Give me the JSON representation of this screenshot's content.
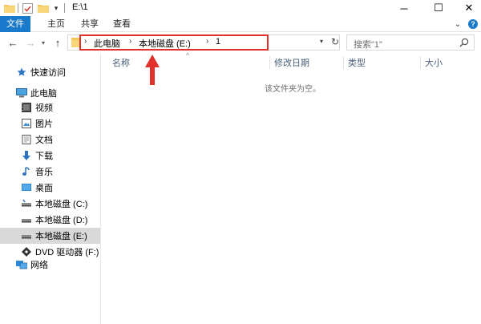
{
  "window": {
    "title": "E:\\1",
    "minimize_glyph": "─",
    "maximize_glyph": "☐",
    "close_glyph": "✕"
  },
  "ribbon": {
    "tabs": [
      "文件",
      "主页",
      "共享",
      "查看"
    ],
    "accent": "#1979ca",
    "help_glyph": "?"
  },
  "address": {
    "crumbs": [
      "此电脑",
      "本地磁盘 (E:)",
      "1"
    ],
    "separator": "›",
    "highlight_color": "#e0312b"
  },
  "search": {
    "placeholder": "搜索\"1\""
  },
  "nav": {
    "quick_access": "快速访问",
    "this_pc": "此电脑",
    "items": [
      "视频",
      "图片",
      "文档",
      "下载",
      "音乐",
      "桌面",
      "本地磁盘 (C:)",
      "本地磁盘 (D:)",
      "本地磁盘 (E:)",
      "DVD 驱动器 (F:) Bo"
    ],
    "network": "网络",
    "selected": "本地磁盘 (E:)"
  },
  "columns": [
    "名称",
    "修改日期",
    "类型",
    "大小"
  ],
  "empty_message": "该文件夹为空。",
  "icons": {
    "quick_access": "star-icon",
    "pc": "computer-icon",
    "video": "video-icon",
    "pictures": "pictures-icon",
    "documents": "documents-icon",
    "downloads": "download-arrow-icon",
    "music": "music-note-icon",
    "desktop": "desktop-icon",
    "drive": "drive-icon",
    "dvd": "dvd-icon",
    "network": "network-icon"
  }
}
